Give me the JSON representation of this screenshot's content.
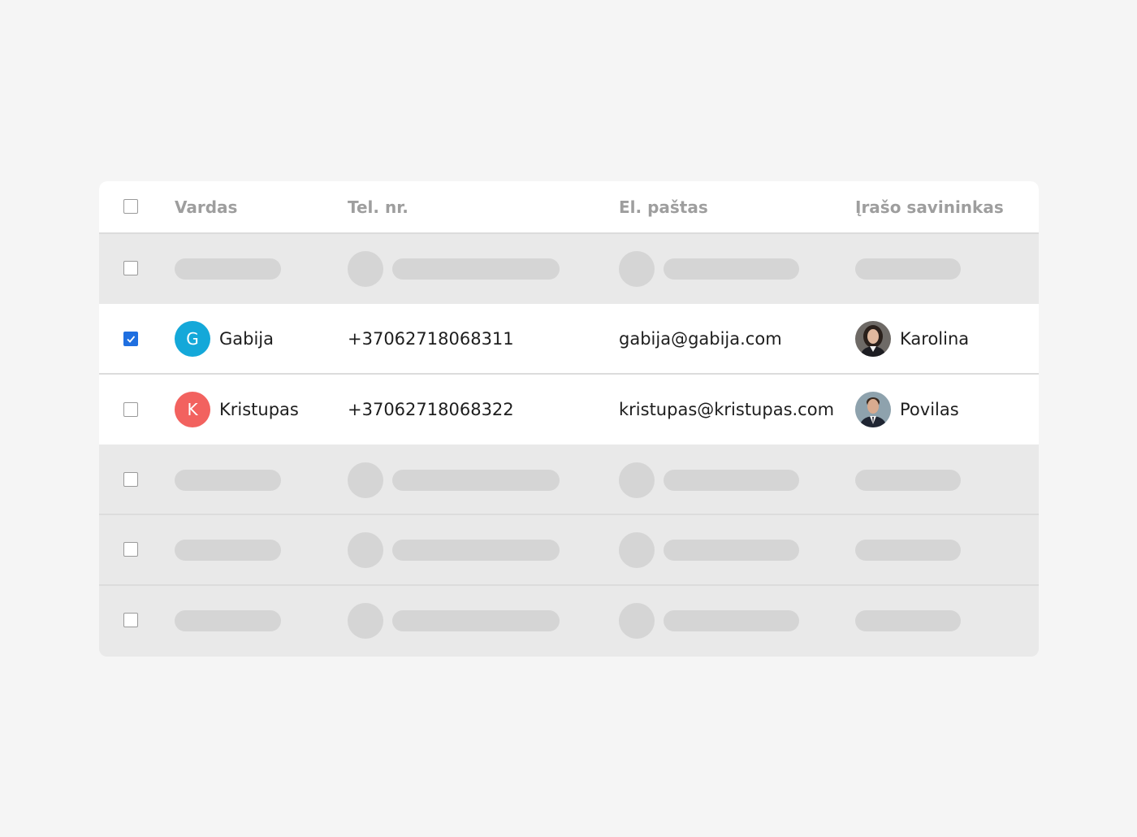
{
  "table": {
    "headers": {
      "name": "Vardas",
      "phone": "Tel. nr.",
      "email": "El. paštas",
      "owner": "Įrašo savininkas"
    },
    "rows": [
      {
        "avatar_initial": "G",
        "avatar_color": "#14a8d9",
        "name": "Gabija",
        "phone": "+37062718068311",
        "email": "gabija@gabija.com",
        "owner": "Karolina",
        "checked": true
      },
      {
        "avatar_initial": "K",
        "avatar_color": "#f2625f",
        "name": "Kristupas",
        "phone": "+37062718068322",
        "email": "kristupas@kristupas.com",
        "owner": "Povilas",
        "checked": false
      }
    ]
  },
  "colors": {
    "checkbox_checked": "#1f6fe0",
    "skeleton": "#d5d5d5"
  }
}
